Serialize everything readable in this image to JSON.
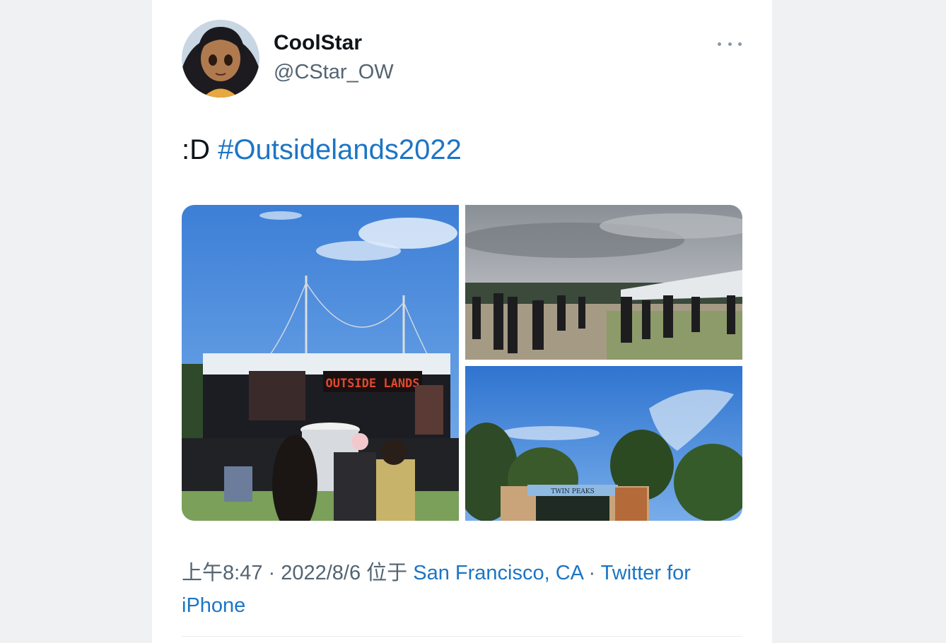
{
  "tweet": {
    "display_name": "CoolStar",
    "handle": "@CStar_OW",
    "text_prefix": ":D ",
    "hashtag": "#Outsidelands2022",
    "more_icon": "more-horizontal-icon",
    "media": [
      {
        "description_name": "stage-photo",
        "sign_text": "OUTSIDE LANDS"
      },
      {
        "description_name": "crowd-photo"
      },
      {
        "description_name": "entrance-photo",
        "sign_text": "TWIN PEAKS"
      }
    ],
    "meta": {
      "time": "上午8:47",
      "sep1": " · ",
      "date": "2022/8/6",
      "location_prefix": " 位于 ",
      "location": "San Francisco, CA",
      "sep2": " · ",
      "source": "Twitter for iPhone"
    }
  },
  "colors": {
    "link": "#1d75c4",
    "text": "#0f1419",
    "muted": "#536471"
  }
}
